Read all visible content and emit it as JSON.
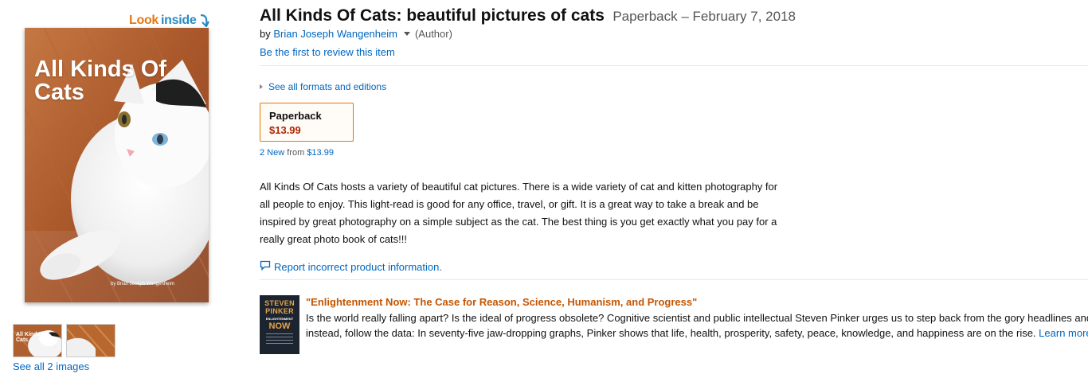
{
  "look_inside": {
    "word1": "Look",
    "word2": "inside"
  },
  "cover": {
    "title": "All Kinds Of Cats",
    "author": "by Brian Joseph Wangenheim"
  },
  "thumbnails": {
    "first_title": "All Kinds Of Cats",
    "see_all_label": "See all 2 images"
  },
  "product": {
    "title": "All Kinds Of Cats: beautiful pictures of cats",
    "binding_date": "Paperback – February 7, 2018",
    "by_prefix": "by",
    "author": "Brian Joseph Wangenheim",
    "author_role": "(Author)",
    "first_review": "Be the first to review this item"
  },
  "formats": {
    "see_all_label": "See all formats and editions",
    "selected": {
      "name": "Paperback",
      "price": "$13.99"
    },
    "new_count": "2 New",
    "from_label": "from",
    "from_price": "$13.99"
  },
  "description": "All Kinds Of Cats hosts a variety of beautiful cat pictures. There is a wide variety of cat and kitten photography for all people to enjoy. This light-read is good for any office, travel, or gift. It is a great way to take a break and be inspired by great photography on a simple subject as the cat. The best thing is you get exactly what you pay for a really great photo book of cats!!!",
  "report_label": "Report incorrect product information.",
  "ad": {
    "cover_line1": "STEVEN",
    "cover_line2": "PINKER",
    "cover_line3": "ENLIGHTENMENT",
    "cover_line4": "NOW",
    "title": "\"Enlightenment Now: The Case for Reason, Science, Humanism, and Progress\"",
    "line1": "Is the world really falling apart? Is the ideal of progress obsolete? Cognitive scientist and public intellectual Steven Pinker urges us to step back from the gory headlines and prophecies of doom",
    "line2_text": "instead, follow the data: In seventy-five jaw-dropping graphs, Pinker shows that life, health, prosperity, safety, peace, knowledge, and happiness are on the rise.",
    "line2_link": "Learn more"
  },
  "colors": {
    "link": "#0066c0",
    "price": "#b12704",
    "ad_title": "#c45500",
    "look_orange": "#e47911",
    "look_blue": "#2a8bc3",
    "format_border": "#e77600"
  }
}
